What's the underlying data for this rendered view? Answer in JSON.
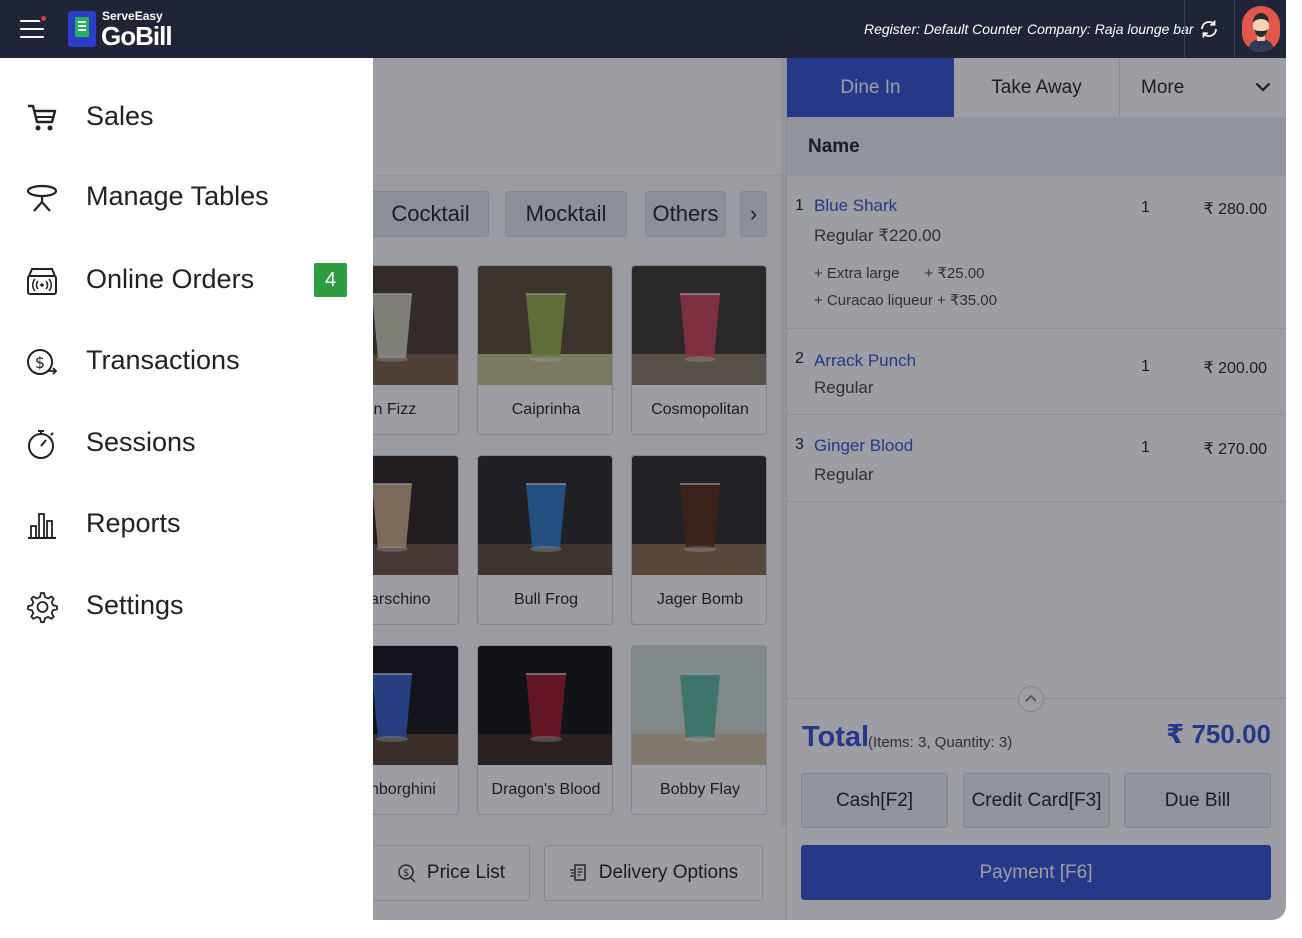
{
  "header": {
    "brand_top": "ServeEasy",
    "brand_main": "GoBill",
    "register": "Register: Default Counter",
    "company": "Company: Raja lounge bar"
  },
  "sidebar": {
    "items": [
      {
        "label": "Sales",
        "icon": "cart-icon"
      },
      {
        "label": "Manage Tables",
        "icon": "table-icon"
      },
      {
        "label": "Online Orders",
        "icon": "online-order-icon",
        "badge": "4"
      },
      {
        "label": "Transactions",
        "icon": "money-transfer-icon"
      },
      {
        "label": "Sessions",
        "icon": "stopwatch-icon"
      },
      {
        "label": "Reports",
        "icon": "bar-chart-icon"
      },
      {
        "label": "Settings",
        "icon": "gear-icon"
      }
    ]
  },
  "categories": {
    "items": [
      "Cocktail",
      "Mocktail",
      "Others"
    ],
    "next": "›"
  },
  "products": [
    {
      "name": "in Fizz",
      "colors": [
        "#4a3a30",
        "#d9d8c0",
        "#7a5f44"
      ]
    },
    {
      "name": "Caiprinha",
      "colors": [
        "#5b4a34",
        "#9db84b",
        "#c9c090"
      ]
    },
    {
      "name": "Cosmopolitan",
      "colors": [
        "#3d3430",
        "#d8455b",
        "#8a7a66"
      ]
    },
    {
      "name": "arschino",
      "colors": [
        "#2b2220",
        "#d9b48a",
        "#6b5040"
      ]
    },
    {
      "name": "Bull Frog",
      "colors": [
        "#2a2524",
        "#2f7fd5",
        "#5a4a3a"
      ]
    },
    {
      "name": "Jager Bomb",
      "colors": [
        "#2e2826",
        "#5b2a14",
        "#8a6a4c"
      ]
    },
    {
      "name": "nborghini",
      "colors": [
        "#151418",
        "#3a62d8",
        "#5a4030"
      ]
    },
    {
      "name": "Dragon's Blood",
      "colors": [
        "#111012",
        "#b0162b",
        "#3a2a20"
      ]
    },
    {
      "name": "Bobby Flay",
      "colors": [
        "#cfd9d3",
        "#4fb597",
        "#d2c0a2"
      ]
    }
  ],
  "bottom_actions": {
    "price_list": "Price List",
    "delivery_options": "Delivery Options"
  },
  "order": {
    "tabs": {
      "dine_in": "Dine In",
      "take_away": "Take Away",
      "more": "More"
    },
    "column_name": "Name",
    "items": [
      {
        "num": "1",
        "name": "Blue Shark",
        "qty": "1",
        "price": "₹ 280.00",
        "variant": "Regular ₹220.00",
        "addons": [
          "+ Extra large      + ₹25.00",
          "+ Curacao liqueur + ₹35.00"
        ]
      },
      {
        "num": "2",
        "name": "Arrack Punch",
        "qty": "1",
        "price": "₹ 200.00",
        "variant": "Regular"
      },
      {
        "num": "3",
        "name": "Ginger Blood",
        "qty": "1",
        "price": "₹ 270.00",
        "variant": "Regular"
      }
    ],
    "total_label": "Total",
    "total_meta": "(Items: 3, Quantity: 3)",
    "total_value": "₹ 750.00",
    "buttons": {
      "cash": "Cash[F2]",
      "credit": "Credit Card[F3]",
      "due": "Due Bill",
      "payment": "Payment [F6]"
    }
  },
  "colors": {
    "header_bg": "#1f2537",
    "accent": "#3552d0",
    "badge_green": "#2d9d3f"
  }
}
